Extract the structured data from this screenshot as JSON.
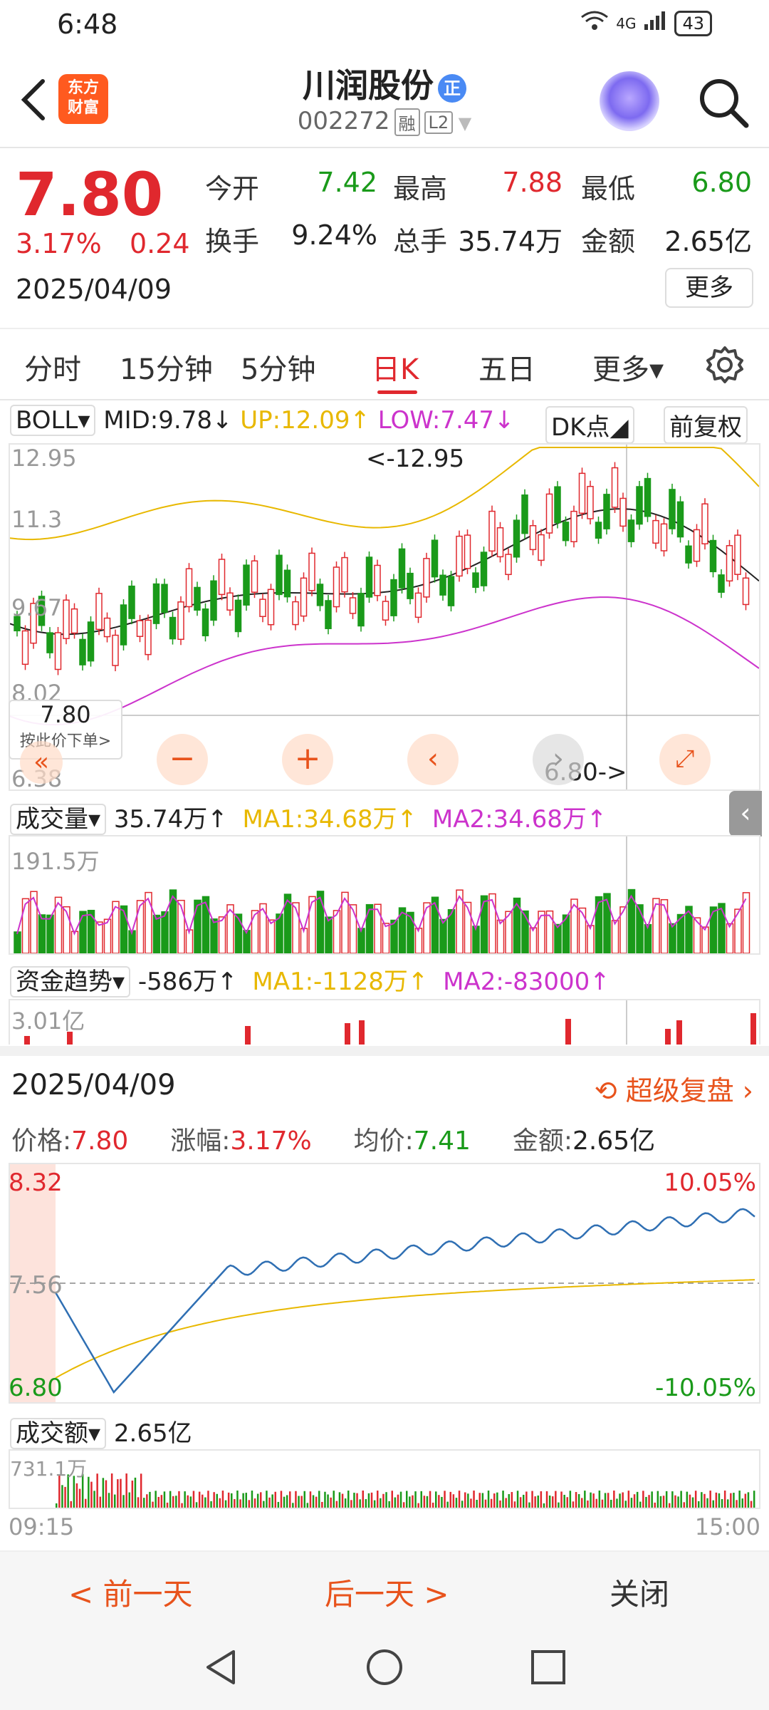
{
  "status": {
    "time": "6:48",
    "signal": "4G",
    "battery": "43"
  },
  "header": {
    "logo_line1": "东方",
    "logo_line2": "财富",
    "name": "川润股份",
    "badge": "正",
    "code": "002272",
    "tag_margin": "融",
    "tag_level": "L2"
  },
  "quote": {
    "price": "7.80",
    "change_pct": "3.17%",
    "change_abs": "0.24",
    "date": "2025/04/09",
    "open_label": "今开",
    "open": "7.42",
    "high_label": "最高",
    "high": "7.88",
    "low_label": "最低",
    "low": "6.80",
    "turnover_label": "换手",
    "turnover": "9.24%",
    "volume_label": "总手",
    "volume": "35.74万",
    "amount_label": "金额",
    "amount": "2.65亿",
    "more": "更多"
  },
  "tabs": [
    {
      "label": "分时"
    },
    {
      "label": "15分钟"
    },
    {
      "label": "5分钟"
    },
    {
      "label": "日K"
    },
    {
      "label": "五日"
    },
    {
      "label": "更多▾"
    }
  ],
  "kline": {
    "indicator": "BOLL▾",
    "mid": "MID:9.78↓",
    "up": "UP:12.09↑",
    "low": "LOW:7.47↓",
    "dk": "DK点◢",
    "adjust": "前复权",
    "y_top": "12.95",
    "y_mid": "11.3",
    "y_9": "9.67",
    "y_8": "8.02",
    "y_bottom": "6.38",
    "max_marker": "<-12.95",
    "min_marker": "6.80->",
    "price_tag": "7.80",
    "price_tag_sub": "按此价下单>",
    "colors": {
      "up": "#e0282e",
      "down": "#1a9a1a",
      "mid": "#222222",
      "upper": "#e8b800",
      "lower": "#cc33cc"
    }
  },
  "volume": {
    "indicator": "成交量▾",
    "value": "35.74万↑",
    "ma1": "MA1:34.68万↑",
    "ma2": "MA2:34.68万↑",
    "y_top": "191.5万"
  },
  "fund": {
    "indicator": "资金趋势▾",
    "value": "-586万↑",
    "ma1": "MA1:-1128万↑",
    "ma2": "MA2:-83000↑",
    "y_top": "3.01亿"
  },
  "intraday": {
    "date": "2025/04/09",
    "replay": "超级复盘",
    "price_label": "价格:",
    "price": "7.80",
    "pct_label": "涨幅:",
    "pct": "3.17%",
    "avg_label": "均价:",
    "avg": "7.41",
    "amt_label": "金额:",
    "amt": "2.65亿",
    "y_top": "8.32",
    "y_mid": "7.56",
    "y_bottom": "6.80",
    "pct_top": "10.05%",
    "pct_bottom": "-10.05%",
    "amount_indicator": "成交额▾",
    "amount_value": "2.65亿",
    "amount_y_top": "731.1万",
    "time_start": "09:15",
    "time_end": "15:00"
  },
  "footer": {
    "prev": "< 前一天",
    "next": "后一天 >",
    "close": "关闭"
  }
}
